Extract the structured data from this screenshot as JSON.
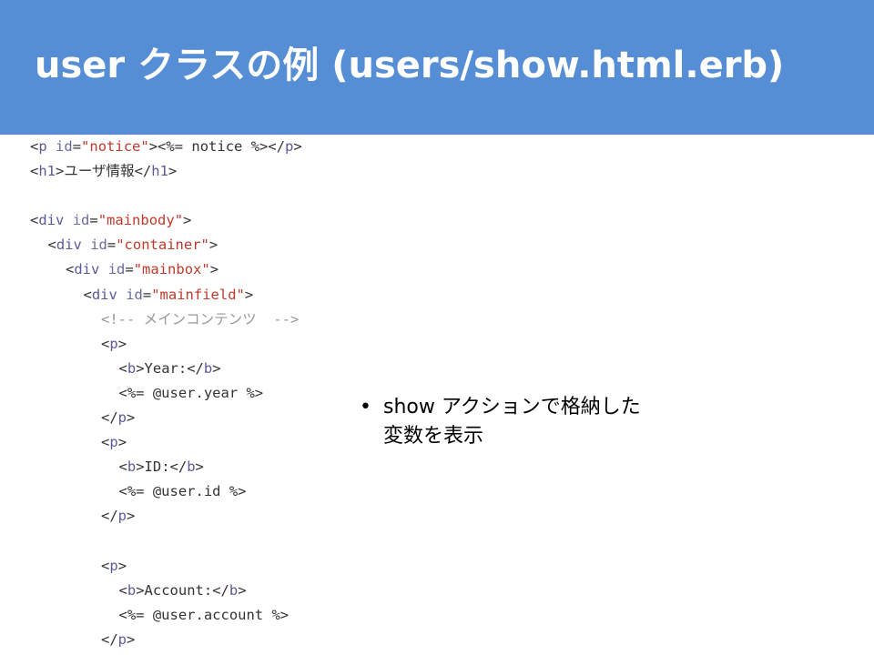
{
  "slide": {
    "title": "user クラスの例 (users/show.html.erb)"
  },
  "code": {
    "lines": [
      {
        "indent": 0,
        "parts": [
          [
            "tag",
            "<"
          ],
          [
            "tag-name",
            "p"
          ],
          [
            "plain",
            " "
          ],
          [
            "attr-name",
            "id"
          ],
          [
            "plain",
            "="
          ],
          [
            "attr-value",
            "\"notice\""
          ],
          [
            "tag",
            ">"
          ],
          [
            "plain",
            "<%= notice %>"
          ],
          [
            "tag",
            "</"
          ],
          [
            "tag-name",
            "p"
          ],
          [
            "tag",
            ">"
          ]
        ]
      },
      {
        "indent": 0,
        "parts": [
          [
            "tag",
            "<"
          ],
          [
            "tag-name",
            "h1"
          ],
          [
            "tag",
            ">"
          ],
          [
            "plain",
            "ユーザ情報"
          ],
          [
            "tag",
            "</"
          ],
          [
            "tag-name",
            "h1"
          ],
          [
            "tag",
            ">"
          ]
        ]
      },
      {
        "indent": 0,
        "parts": []
      },
      {
        "indent": 0,
        "parts": [
          [
            "tag",
            "<"
          ],
          [
            "tag-name",
            "div"
          ],
          [
            "plain",
            " "
          ],
          [
            "attr-name",
            "id"
          ],
          [
            "plain",
            "="
          ],
          [
            "attr-value",
            "\"mainbody\""
          ],
          [
            "tag",
            ">"
          ]
        ]
      },
      {
        "indent": 1,
        "parts": [
          [
            "tag",
            "<"
          ],
          [
            "tag-name",
            "div"
          ],
          [
            "plain",
            " "
          ],
          [
            "attr-name",
            "id"
          ],
          [
            "plain",
            "="
          ],
          [
            "attr-value",
            "\"container\""
          ],
          [
            "tag",
            ">"
          ]
        ]
      },
      {
        "indent": 2,
        "parts": [
          [
            "tag",
            "<"
          ],
          [
            "tag-name",
            "div"
          ],
          [
            "plain",
            " "
          ],
          [
            "attr-name",
            "id"
          ],
          [
            "plain",
            "="
          ],
          [
            "attr-value",
            "\"mainbox\""
          ],
          [
            "tag",
            ">"
          ]
        ]
      },
      {
        "indent": 3,
        "parts": [
          [
            "tag",
            "<"
          ],
          [
            "tag-name",
            "div"
          ],
          [
            "plain",
            " "
          ],
          [
            "attr-name",
            "id"
          ],
          [
            "plain",
            "="
          ],
          [
            "attr-value",
            "\"mainfield\""
          ],
          [
            "tag",
            ">"
          ]
        ]
      },
      {
        "indent": 4,
        "parts": [
          [
            "comment",
            "<!-- メインコンテンツ  -->"
          ]
        ]
      },
      {
        "indent": 4,
        "parts": [
          [
            "tag",
            "<"
          ],
          [
            "tag-name",
            "p"
          ],
          [
            "tag",
            ">"
          ]
        ]
      },
      {
        "indent": 5,
        "parts": [
          [
            "tag",
            "<"
          ],
          [
            "tag-name",
            "b"
          ],
          [
            "tag",
            ">"
          ],
          [
            "plain",
            "Year:"
          ],
          [
            "tag",
            "</"
          ],
          [
            "tag-name",
            "b"
          ],
          [
            "tag",
            ">"
          ]
        ]
      },
      {
        "indent": 5,
        "parts": [
          [
            "plain",
            "<%= @user.year %>"
          ]
        ]
      },
      {
        "indent": 4,
        "parts": [
          [
            "tag",
            "</"
          ],
          [
            "tag-name",
            "p"
          ],
          [
            "tag",
            ">"
          ]
        ]
      },
      {
        "indent": 4,
        "parts": [
          [
            "tag",
            "<"
          ],
          [
            "tag-name",
            "p"
          ],
          [
            "tag",
            ">"
          ]
        ]
      },
      {
        "indent": 5,
        "parts": [
          [
            "tag",
            "<"
          ],
          [
            "tag-name",
            "b"
          ],
          [
            "tag",
            ">"
          ],
          [
            "plain",
            "ID:"
          ],
          [
            "tag",
            "</"
          ],
          [
            "tag-name",
            "b"
          ],
          [
            "tag",
            ">"
          ]
        ]
      },
      {
        "indent": 5,
        "parts": [
          [
            "plain",
            "<%= @user.id %>"
          ]
        ]
      },
      {
        "indent": 4,
        "parts": [
          [
            "tag",
            "</"
          ],
          [
            "tag-name",
            "p"
          ],
          [
            "tag",
            ">"
          ]
        ]
      },
      {
        "indent": 0,
        "parts": []
      },
      {
        "indent": 4,
        "parts": [
          [
            "tag",
            "<"
          ],
          [
            "tag-name",
            "p"
          ],
          [
            "tag",
            ">"
          ]
        ]
      },
      {
        "indent": 5,
        "parts": [
          [
            "tag",
            "<"
          ],
          [
            "tag-name",
            "b"
          ],
          [
            "tag",
            ">"
          ],
          [
            "plain",
            "Account:"
          ],
          [
            "tag",
            "</"
          ],
          [
            "tag-name",
            "b"
          ],
          [
            "tag",
            ">"
          ]
        ]
      },
      {
        "indent": 5,
        "parts": [
          [
            "plain",
            "<%= @user.account %>"
          ]
        ]
      },
      {
        "indent": 4,
        "parts": [
          [
            "tag",
            "</"
          ],
          [
            "tag-name",
            "p"
          ],
          [
            "tag",
            ">"
          ]
        ]
      }
    ]
  },
  "bullets": [
    {
      "symbol": "•",
      "text": "show アクションで格納した変数を表示"
    }
  ],
  "colors": {
    "title_bar": "#558ed5",
    "title_text": "#ffffff",
    "attr_value": "#c0392b",
    "tag_name": "#5a5a9a",
    "comment": "#999999"
  }
}
